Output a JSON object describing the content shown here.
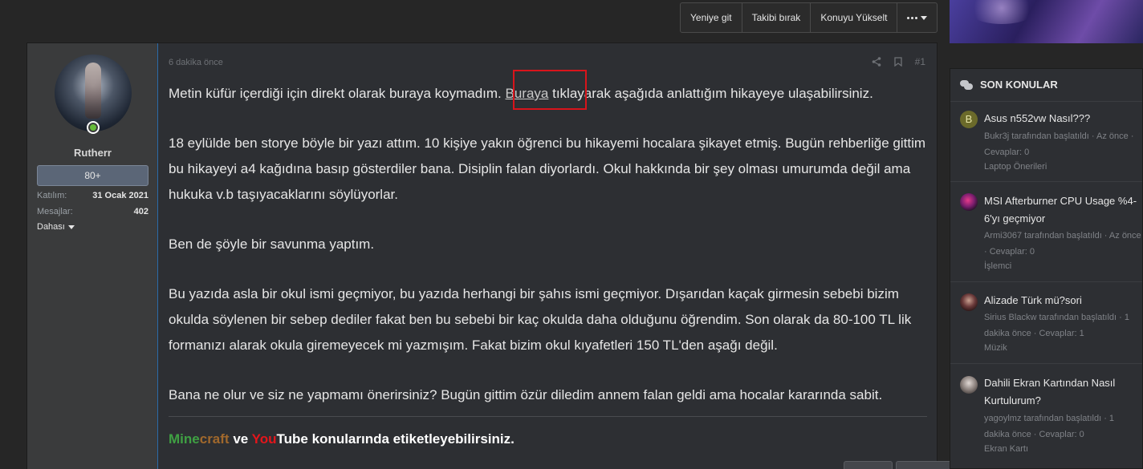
{
  "thread_actions": {
    "go_new": "Yeniye git",
    "unfollow": "Takibi bırak",
    "bump": "Konuyu Yükselt"
  },
  "user": {
    "name": "Rutherr",
    "rank": "80+",
    "joined_label": "Katılım:",
    "joined_value": "31 Ocak 2021",
    "messages_label": "Mesajlar:",
    "messages_value": "402",
    "more_label": "Dahası"
  },
  "post": {
    "time": "6 dakika önce",
    "number": "#1",
    "para1_before": "Metin küfür içerdiği için direkt olarak buraya koymadım. ",
    "para1_link": "Buraya",
    "para1_after": " tıklayarak aşağıda anlattığım hikayeye ulaşabilirsiniz.",
    "para2": "18 eylülde ben storye böyle bir yazı attım. 10 kişiye yakın öğrenci bu hikayemi hocalara şikayet etmiş. Bugün rehberliğe gittim bu hikayeyi a4 kağıdına basıp gösterdiler bana. Disiplin falan diyorlardı. Okul hakkında bir şey olması umurumda değil ama hukuka v.b taşıyacaklarını söylüyorlar.",
    "para3": "Ben de şöyle bir savunma yaptım.",
    "para4": "Bu yazıda asla bir okul ismi geçmiyor, bu yazıda herhangi bir şahıs ismi geçmiyor. Dışarıdan kaçak girmesin sebebi bizim okulda söylenen bir sebep dediler fakat ben bu sebebi bir kaç okulda daha olduğunu öğrendim. Son olarak da 80-100 TL lik formanızı alarak okula giremeyecek mi yazmışım. Fakat bizim okul kıyafetleri 150 TL'den aşağı değil.",
    "para5": "Bana ne olur ve siz ne yapmamı önerirsiniz? Bugün gittim özür diledim annem falan geldi ama hocalar kararında sabit."
  },
  "signature": {
    "mine": "Mine",
    "craft": "craft",
    "ve": " ve ",
    "you": "You",
    "tube": "Tube",
    "rest": " konularında etiketleyebilirsiniz."
  },
  "sidebar": {
    "title": "SON KONULAR",
    "items": [
      {
        "avatar_letter": "B",
        "title": "Asus n552vw Nasıl???",
        "meta": "Bukr3j tarafından başlatıldı · Az önce · Cevaplar: 0",
        "forum": "Laptop Önerileri"
      },
      {
        "title": "MSI Afterburner CPU Usage %4-6'yı geçmiyor",
        "meta": "Armi3067 tarafından başlatıldı · Az önce · Cevaplar: 0",
        "forum": "İşlemci"
      },
      {
        "title": "Alizade Türk mü?sori",
        "meta": "Sirius Blackw tarafından başlatıldı · 1 dakika önce · Cevaplar: 1",
        "forum": "Müzik"
      },
      {
        "title": "Dahili Ekran Kartından Nasıl Kurtulurum?",
        "meta": "yagoylmz tarafından başlatıldı · 1 dakika önce · Cevaplar: 0",
        "forum": "Ekran Kartı"
      }
    ]
  },
  "colors": {
    "highlight_box": "#d8141b",
    "minecraft_green": "#3fa043",
    "minecraft_brown": "#a0682c",
    "youtube_red": "#e4151b"
  }
}
